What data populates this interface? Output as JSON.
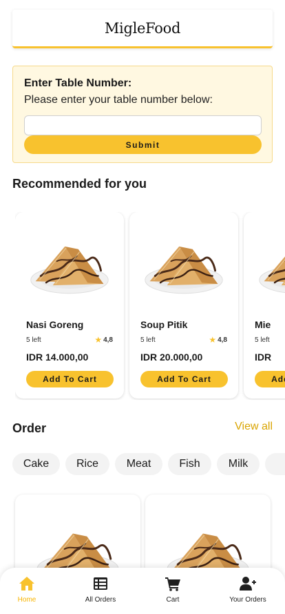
{
  "app": {
    "brand": "MigleFood"
  },
  "table": {
    "title": "Enter Table Number:",
    "subtitle": "Please enter your table number below:",
    "input_value": "",
    "input_placeholder": "",
    "submit_label": "Submit"
  },
  "recommended": {
    "title": "Recommended for you",
    "items": [
      {
        "name": "Nasi Goreng",
        "stock": "5 left",
        "rating": "4,8",
        "price": "IDR 14.000,00",
        "button": "Add To Cart"
      },
      {
        "name": "Soup Pitik",
        "stock": "5 left",
        "rating": "4,8",
        "price": "IDR 20.000,00",
        "button": "Add To Cart"
      },
      {
        "name": "Mie",
        "stock": "5 left",
        "rating": "",
        "price": "IDR",
        "button": "Add To Cart"
      }
    ]
  },
  "order": {
    "title": "Order",
    "view_all": "View all",
    "categories": [
      "Cake",
      "Rice",
      "Meat",
      "Fish",
      "Milk",
      ""
    ]
  },
  "nav": {
    "items": [
      {
        "label": "Home",
        "icon": "home-icon",
        "active": true
      },
      {
        "label": "All Orders",
        "icon": "list-icon",
        "active": false
      },
      {
        "label": "Cart",
        "icon": "cart-icon",
        "active": false
      },
      {
        "label": "Your Orders",
        "icon": "user-plus-icon",
        "active": false
      }
    ]
  },
  "colors": {
    "accent": "#f8c22e",
    "accent_text": "#d9a400",
    "panel_bg": "#fff8e1",
    "chip_bg": "#f3f3f3"
  }
}
